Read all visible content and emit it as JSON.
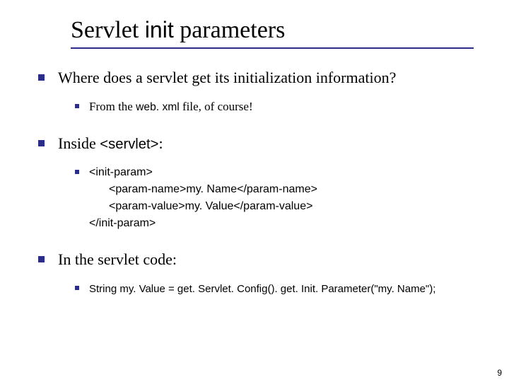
{
  "title": {
    "part1": "Servlet ",
    "mono": "init",
    "part2": " parameters"
  },
  "bullets": [
    {
      "text_pre": "Where does a servlet get its initialization information?",
      "sub": [
        {
          "pre": "From the ",
          "mono": "web. xml",
          "post": " file, of course!"
        }
      ]
    },
    {
      "text_pre": "Inside ",
      "text_mono": "<servlet>",
      "text_post": ":",
      "sub": [
        {
          "code": {
            "l1": "<init-param>",
            "l2": "<param-name>my. Name</param-name>",
            "l3": "<param-value>my. Value</param-value>",
            "l4": "</init-param>"
          }
        }
      ]
    },
    {
      "text_pre": "In the servlet code:",
      "sub": [
        {
          "mono_full": "String my. Value = get. Servlet. Config(). get. Init. Parameter(\"my. Name\");"
        }
      ]
    }
  ],
  "page_number": "9"
}
